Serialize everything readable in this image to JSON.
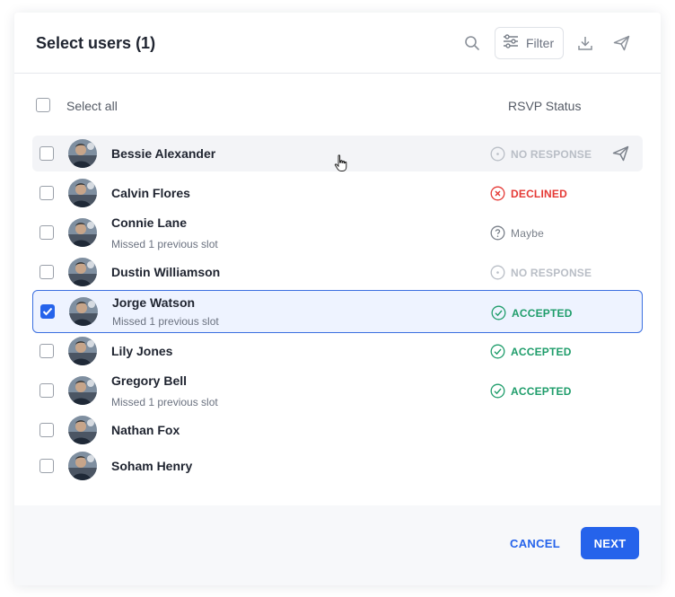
{
  "dialog": {
    "title": "Select users (1)",
    "filter_label": "Filter",
    "icons": [
      "search-icon",
      "filter-sliders-icon",
      "download-icon",
      "send-icon"
    ]
  },
  "list_header": {
    "select_all_label": "Select all",
    "rsvp_column_label": "RSVP Status"
  },
  "users": [
    {
      "name": "Bessie Alexander",
      "subtitle": "",
      "status": "NO RESPONSE",
      "status_kind": "no-response",
      "checked": false
    },
    {
      "name": "Calvin Flores",
      "subtitle": "",
      "status": "DECLINED",
      "status_kind": "declined",
      "checked": false
    },
    {
      "name": "Connie Lane",
      "subtitle": "Missed 1 previous slot",
      "status": "Maybe",
      "status_kind": "maybe",
      "checked": false
    },
    {
      "name": "Dustin Williamson",
      "subtitle": "",
      "status": "NO RESPONSE",
      "status_kind": "no-response",
      "checked": false
    },
    {
      "name": "Jorge Watson",
      "subtitle": "Missed 1 previous slot",
      "status": "ACCEPTED",
      "status_kind": "accepted",
      "checked": true
    },
    {
      "name": "Lily Jones",
      "subtitle": "",
      "status": "ACCEPTED",
      "status_kind": "accepted",
      "checked": false
    },
    {
      "name": "Gregory Bell",
      "subtitle": "Missed 1 previous slot",
      "status": "ACCEPTED",
      "status_kind": "accepted",
      "checked": false
    },
    {
      "name": "Nathan Fox",
      "subtitle": "",
      "status": "",
      "status_kind": "none",
      "checked": false
    },
    {
      "name": "Soham Henry",
      "subtitle": "",
      "status": "",
      "status_kind": "none",
      "checked": false
    }
  ],
  "footer": {
    "cancel_label": "CANCEL",
    "next_label": "NEXT"
  },
  "colors": {
    "accent": "#2563eb",
    "accepted": "#1f9d6b",
    "declined": "#e53935",
    "maybe": "#7a808a",
    "no_response": "#b9bec6"
  }
}
